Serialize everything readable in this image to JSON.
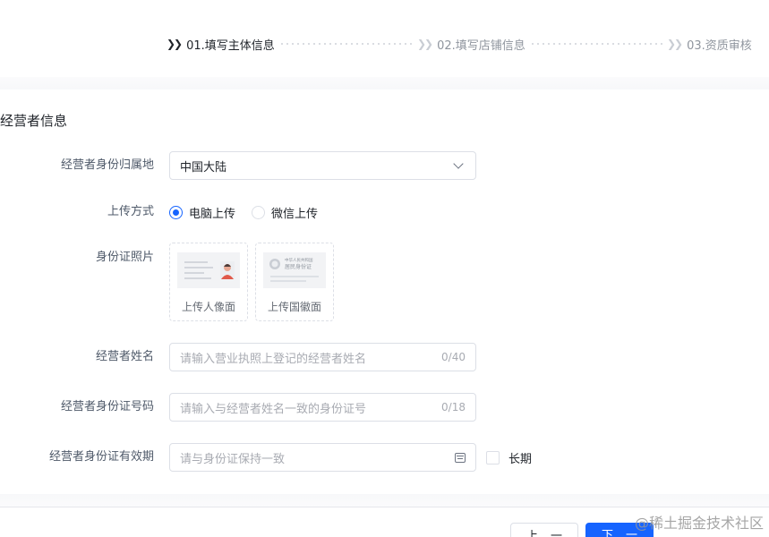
{
  "steps": [
    {
      "label": "01.填写主体信息",
      "state": "active"
    },
    {
      "label": "02.填写店铺信息",
      "state": "inactive"
    },
    {
      "label": "03.资质审核",
      "state": "inactive"
    }
  ],
  "section": {
    "title": "经营者信息"
  },
  "form": {
    "region": {
      "label": "经营者身份归属地",
      "value": "中国大陆"
    },
    "upload_method": {
      "label": "上传方式",
      "options": [
        {
          "label": "电脑上传",
          "checked": true
        },
        {
          "label": "微信上传",
          "checked": false
        }
      ]
    },
    "id_photo": {
      "label": "身份证照片",
      "cards": [
        {
          "caption": "上传人像面"
        },
        {
          "caption": "上传国徽面",
          "thumb_title_1": "中华人民共和国",
          "thumb_title_2": "居民身份证"
        }
      ]
    },
    "name": {
      "label": "经营者姓名",
      "placeholder": "请输入营业执照上登记的经营者姓名",
      "counter": "0/40"
    },
    "id_number": {
      "label": "经营者身份证号码",
      "placeholder": "请输入与经营者姓名一致的身份证号",
      "counter": "0/18"
    },
    "id_validity": {
      "label": "经营者身份证有效期",
      "placeholder": "请与身份证保持一致",
      "long_term_label": "长期"
    }
  },
  "footer": {
    "prev_label": "上一步",
    "next_label": "下一步"
  },
  "watermark": "@稀土掘金技术社区",
  "colors": {
    "primary": "#1664ff",
    "text": "#1f2329",
    "muted": "#a8abb2",
    "border": "#dcdfe6"
  }
}
